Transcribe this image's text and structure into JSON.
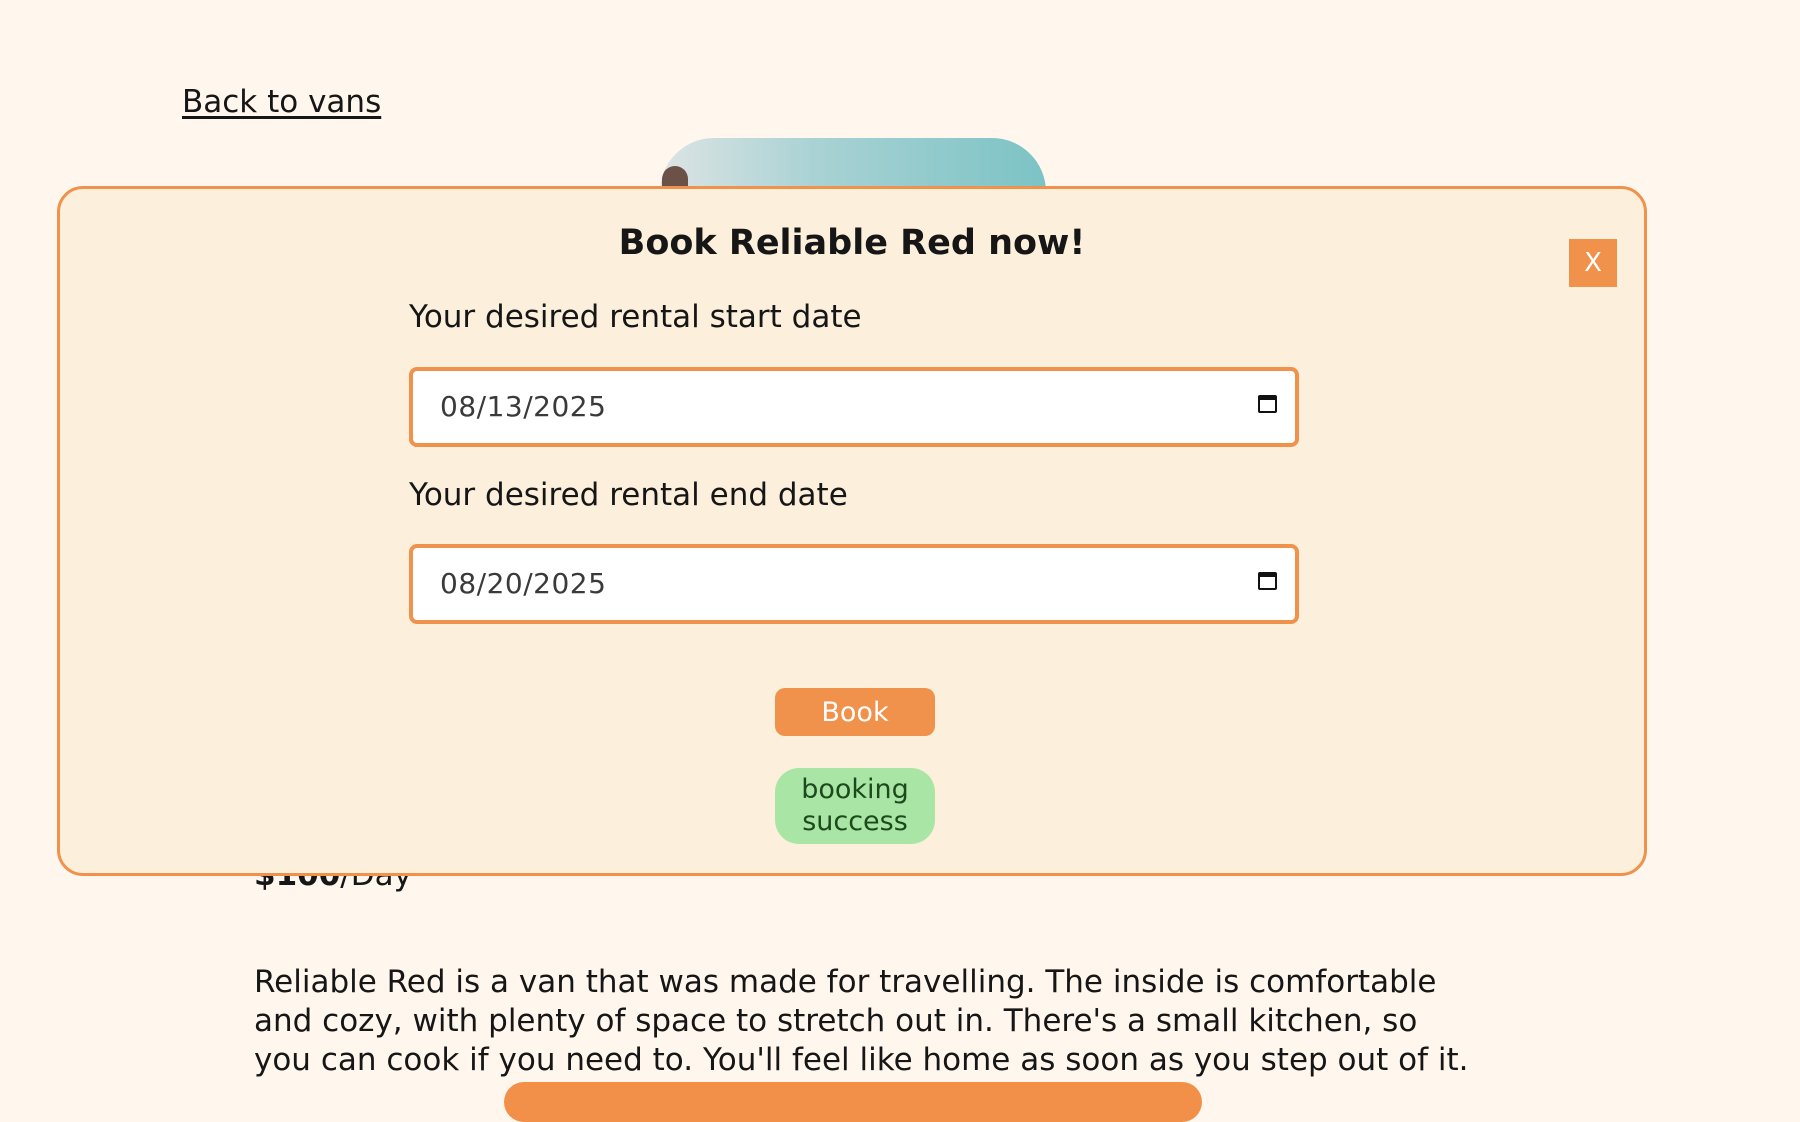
{
  "page": {
    "back_link": "Back to vans",
    "van_image_alt": "Reliable Red van",
    "price": {
      "amount": "$100",
      "unit": "/Day"
    },
    "description": "Reliable Red is a van that was made for travelling. The inside is comfortable and cozy, with plenty of space to stretch out in. There's a small kitchen, so you can cook if you need to. You'll feel like home as soon as you step out of it."
  },
  "modal": {
    "title": "Book Reliable Red now!",
    "close_label": "X",
    "start_date_label": "Your desired rental start date",
    "start_date_value": "08/13/2025",
    "end_date_label": "Your desired rental end date",
    "end_date_value": "08/20/2025",
    "book_label": "Book",
    "status_text": "booking success"
  },
  "icons": {
    "date_picker": "calendar-icon"
  },
  "colors": {
    "background": "#FFF7ED",
    "modal_background": "#FCEFDC",
    "accent": "#F0914C",
    "success_badge": "#A9E6A5"
  }
}
